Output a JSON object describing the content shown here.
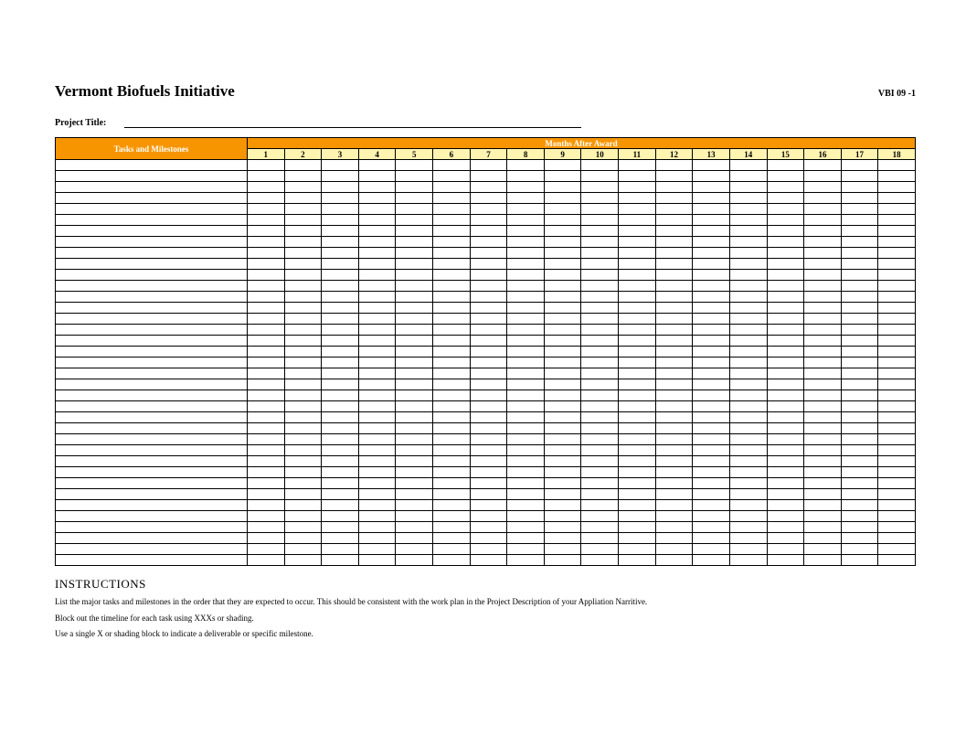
{
  "doc": {
    "title": "Vermont Biofuels Initiative",
    "id": "VBI 09 -1",
    "project_label": "Project Title:",
    "project_value": ""
  },
  "table": {
    "tasks_header": "Tasks and Milestones",
    "months_header": "Months After Award",
    "months": [
      "1",
      "2",
      "3",
      "4",
      "5",
      "6",
      "7",
      "8",
      "9",
      "10",
      "11",
      "12",
      "13",
      "14",
      "15",
      "16",
      "17",
      "18"
    ],
    "row_count": 37
  },
  "instructions": {
    "title": "INSTRUCTIONS",
    "lines": [
      "List the major tasks and milestones in the order that they are expected to occur. This should be consistent with the work plan in the Project Description of your Appliation Narritive.",
      "Block out the timeline for each task using XXXs or shading.",
      "Use a single X or shading block to indicate a deliverable or specific milestone."
    ]
  }
}
